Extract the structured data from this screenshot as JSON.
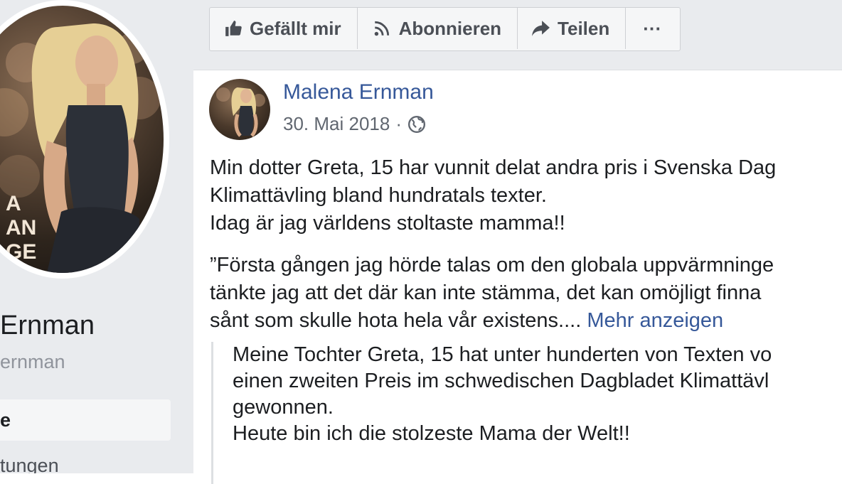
{
  "page": {
    "name": "Ernman",
    "handle": "ernman",
    "nav": {
      "home_label": "e",
      "events_label": "tungen"
    },
    "cover_text_lines": [
      "A",
      "AN",
      "GE"
    ]
  },
  "actions": [
    {
      "label": "Gefällt mir",
      "icon": "thumbs-up-icon"
    },
    {
      "label": "Abonnieren",
      "icon": "rss-icon"
    },
    {
      "label": "Teilen",
      "icon": "share-arrow-icon"
    },
    {
      "label": "···",
      "icon": "more-icon"
    }
  ],
  "post": {
    "author": "Malena Ernman",
    "date": "30. Mai 2018",
    "separator": "·",
    "privacy_icon": "globe-icon",
    "text_lines": [
      "Min dotter Greta, 15 har vunnit delat andra pris i Svenska Dag",
      "Klimattävling bland hundratals texter.",
      "Idag är jag världens stoltaste mamma!!"
    ],
    "quote_lines": [
      "”Första gången jag hörde talas om den globala uppvärmninge",
      "tänkte jag att det där kan inte stämma, det kan omöjligt finna",
      "sånt som skulle hota hela vår existens...."
    ],
    "see_more": "Mehr anzeigen",
    "translation_lines": [
      "Meine Tochter Greta, 15 hat unter hunderten von Texten vo",
      "einen zweiten Preis im schwedischen Dagbladet Klimattävl",
      "gewonnen.",
      "Heute bin ich die stolzeste Mama der Welt!!"
    ]
  },
  "colors": {
    "link": "#365899",
    "background": "#e9ebee",
    "muted": "#90949c"
  }
}
